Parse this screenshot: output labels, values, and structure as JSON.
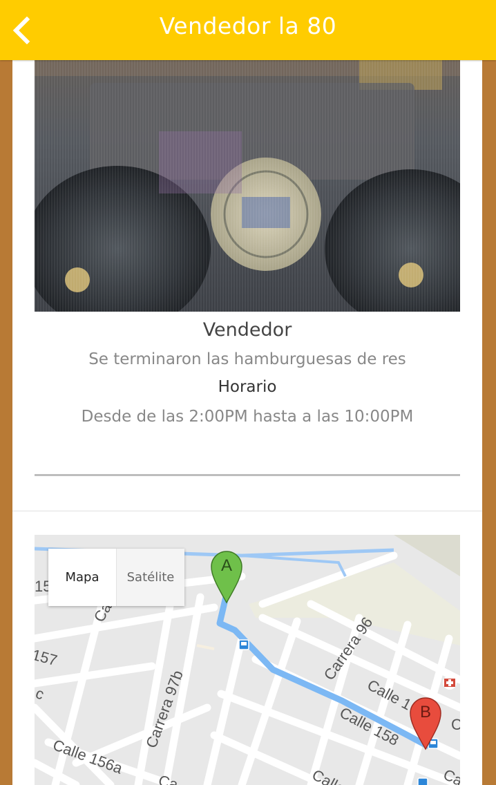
{
  "header": {
    "title": "Vendedor la 80"
  },
  "vendor": {
    "name": "Vendedor",
    "status": "Se terminaron las hamburguesas de res",
    "schedule_label": "Horario",
    "schedule": "Desde de las 2:00PM hasta a las 10:00PM"
  },
  "map": {
    "type_buttons": [
      "Mapa",
      "Satélite"
    ],
    "selected": "Mapa",
    "markers": [
      {
        "label": "A",
        "color": "#6fc04a"
      },
      {
        "label": "B",
        "color": "#e84c3d"
      }
    ],
    "street_labels": [
      "Carrera 96",
      "Carrera 97b",
      "Calle 158",
      "Calle 156a",
      "Calle 1",
      "157",
      "15",
      "Ca",
      "Calle",
      "Ca",
      "c",
      "C",
      "Ca"
    ],
    "route_color": "#7cb8f4"
  }
}
